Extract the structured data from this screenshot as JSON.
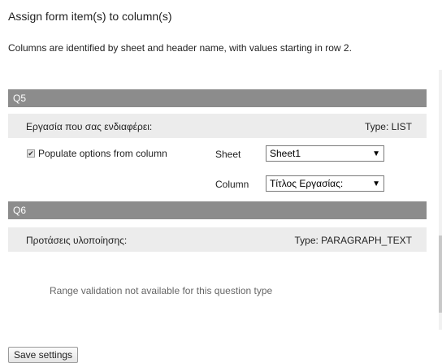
{
  "page": {
    "title": "Assign form item(s) to column(s)",
    "description": "Columns are identified by sheet and header name, with values starting in row 2."
  },
  "questions": [
    {
      "id": "Q5",
      "label": "Εργασία που σας ενδιαφέρει:",
      "type": "Type: LIST",
      "populate_label": "Populate options from column",
      "populate_checked": true,
      "sheet_label": "Sheet",
      "sheet_value": "Sheet1",
      "column_label": "Column",
      "column_value": "Τίτλος Εργασίας:"
    },
    {
      "id": "Q6",
      "label": "Προτάσεις υλοποίησης:",
      "type": "Type: PARAGRAPH_TEXT",
      "note": "Range validation not available for this question type"
    }
  ],
  "footer": {
    "save_label": "Save settings"
  },
  "icons": {
    "dropdown": "chevron-down-icon",
    "check": "checkmark-icon"
  }
}
